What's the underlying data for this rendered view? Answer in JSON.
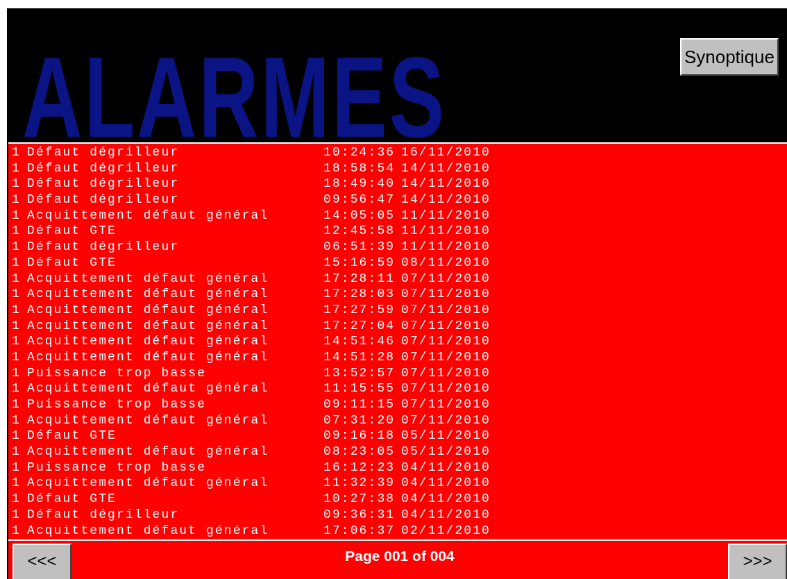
{
  "header": {
    "title": "ALARMES",
    "button": "Synoptique"
  },
  "alarms": [
    {
      "count": "1",
      "message": "Défaut dégrilleur",
      "time": "10:24:36",
      "date": "16/11/2010"
    },
    {
      "count": "1",
      "message": "Défaut dégrilleur",
      "time": "18:58:54",
      "date": "14/11/2010"
    },
    {
      "count": "1",
      "message": "Défaut dégrilleur",
      "time": "18:49:40",
      "date": "14/11/2010"
    },
    {
      "count": "1",
      "message": "Défaut dégrilleur",
      "time": "09:56:47",
      "date": "14/11/2010"
    },
    {
      "count": "1",
      "message": "Acquittement défaut général",
      "time": "14:05:05",
      "date": "11/11/2010"
    },
    {
      "count": "1",
      "message": "Défaut GTE",
      "time": "12:45:58",
      "date": "11/11/2010"
    },
    {
      "count": "1",
      "message": "Défaut dégrilleur",
      "time": "06:51:39",
      "date": "11/11/2010"
    },
    {
      "count": "1",
      "message": "Défaut GTE",
      "time": "15:16:59",
      "date": "08/11/2010"
    },
    {
      "count": "1",
      "message": "Acquittement défaut général",
      "time": "17:28:11",
      "date": "07/11/2010"
    },
    {
      "count": "1",
      "message": "Acquittement défaut général",
      "time": "17:28:03",
      "date": "07/11/2010"
    },
    {
      "count": "1",
      "message": "Acquittement défaut général",
      "time": "17:27:59",
      "date": "07/11/2010"
    },
    {
      "count": "1",
      "message": "Acquittement défaut général",
      "time": "17:27:04",
      "date": "07/11/2010"
    },
    {
      "count": "1",
      "message": "Acquittement défaut général",
      "time": "14:51:46",
      "date": "07/11/2010"
    },
    {
      "count": "1",
      "message": "Acquittement défaut général",
      "time": "14:51:28",
      "date": "07/11/2010"
    },
    {
      "count": "1",
      "message": "Puissance trop basse",
      "time": "13:52:57",
      "date": "07/11/2010"
    },
    {
      "count": "1",
      "message": "Acquittement défaut général",
      "time": "11:15:55",
      "date": "07/11/2010"
    },
    {
      "count": "1",
      "message": "Puissance trop basse",
      "time": "09:11:15",
      "date": "07/11/2010"
    },
    {
      "count": "1",
      "message": "Acquittement défaut général",
      "time": "07:31:20",
      "date": "07/11/2010"
    },
    {
      "count": "1",
      "message": "Défaut GTE",
      "time": "09:16:18",
      "date": "05/11/2010"
    },
    {
      "count": "1",
      "message": "Acquittement défaut général",
      "time": "08:23:05",
      "date": "05/11/2010"
    },
    {
      "count": "1",
      "message": "Puissance trop basse",
      "time": "16:12:23",
      "date": "04/11/2010"
    },
    {
      "count": "1",
      "message": "Acquittement défaut général",
      "time": "11:32:39",
      "date": "04/11/2010"
    },
    {
      "count": "1",
      "message": "Défaut GTE",
      "time": "10:27:38",
      "date": "04/11/2010"
    },
    {
      "count": "1",
      "message": "Défaut dégrilleur",
      "time": "09:36:31",
      "date": "04/11/2010"
    },
    {
      "count": "1",
      "message": "Acquittement défaut général",
      "time": "17:06:37",
      "date": "02/11/2010"
    }
  ],
  "footer": {
    "previous": "<<<",
    "page": "Page 001 of 004",
    "next": ">>>"
  }
}
